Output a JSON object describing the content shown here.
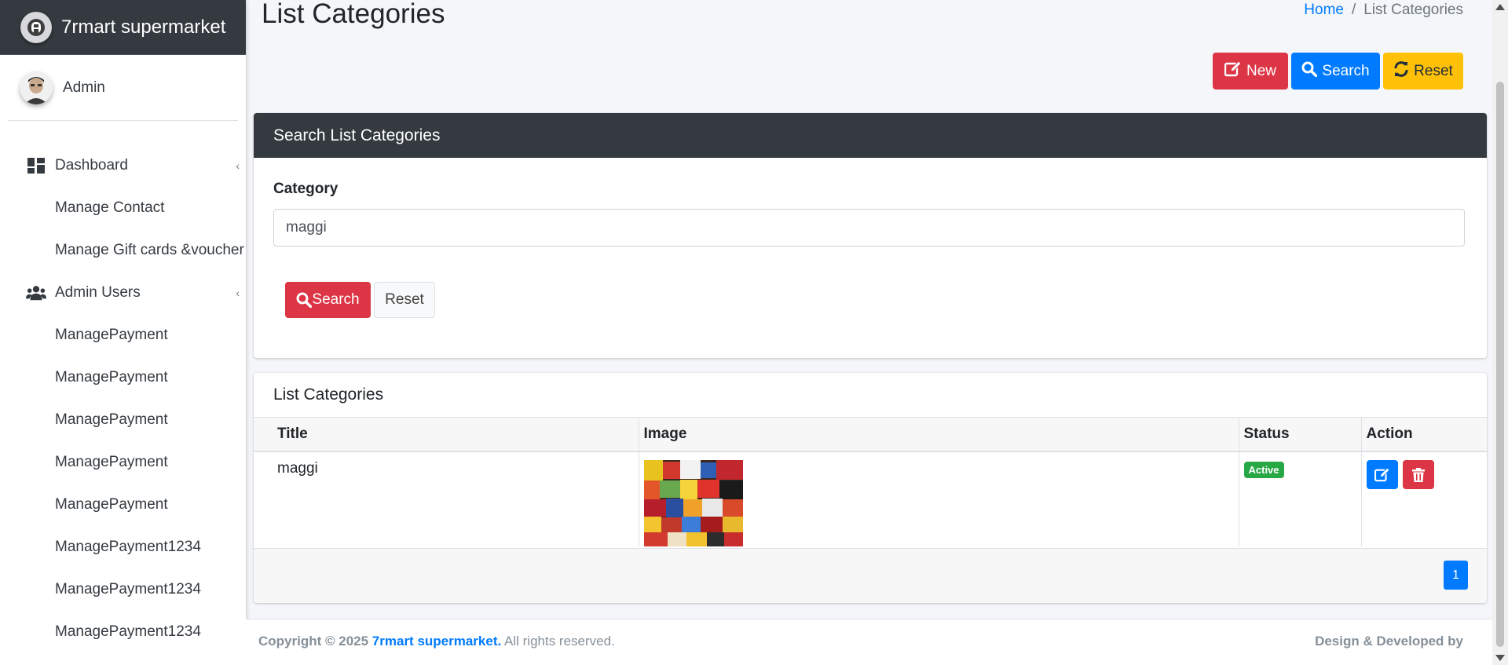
{
  "brand": {
    "name": "7rmart supermarket"
  },
  "user": {
    "name": "Admin"
  },
  "sidebar": {
    "items": [
      {
        "label": "Dashboard",
        "icon": "dashboard-icon",
        "caret": "‹"
      },
      {
        "label": "Manage Contact"
      },
      {
        "label": "Manage Gift cards &voucher"
      },
      {
        "label": "Admin Users",
        "icon": "users-icon",
        "caret": "‹"
      },
      {
        "label": "ManagePayment"
      },
      {
        "label": "ManagePayment"
      },
      {
        "label": "ManagePayment"
      },
      {
        "label": "ManagePayment"
      },
      {
        "label": "ManagePayment"
      },
      {
        "label": "ManagePayment1234"
      },
      {
        "label": "ManagePayment1234"
      },
      {
        "label": "ManagePayment1234"
      }
    ]
  },
  "header": {
    "title": "List Categories",
    "breadcrumb": {
      "home": "Home",
      "separator": "/",
      "current": "List Categories"
    }
  },
  "toolbar": {
    "new_label": "New",
    "search_label": "Search",
    "reset_label": "Reset"
  },
  "search_card": {
    "title": "Search List Categories",
    "category_label": "Category",
    "category_value": "maggi",
    "search_button": "Search",
    "reset_button": "Reset"
  },
  "list_card": {
    "title": "List Categories",
    "columns": [
      "Title",
      "Image",
      "Status",
      "Action"
    ],
    "rows": [
      {
        "title": "maggi",
        "status": "Active"
      }
    ],
    "pagination": {
      "current_page": "1"
    }
  },
  "footer": {
    "copyright_prefix": "Copyright © 2025",
    "company": "7rmart supermarket.",
    "rights": "All rights reserved.",
    "right_text": "Design & Developed by"
  },
  "colors": {
    "sidebar_brand_bg": "#343a40",
    "danger": "#dc3545",
    "primary": "#007bff",
    "warning": "#ffc107",
    "success": "#28a745"
  }
}
